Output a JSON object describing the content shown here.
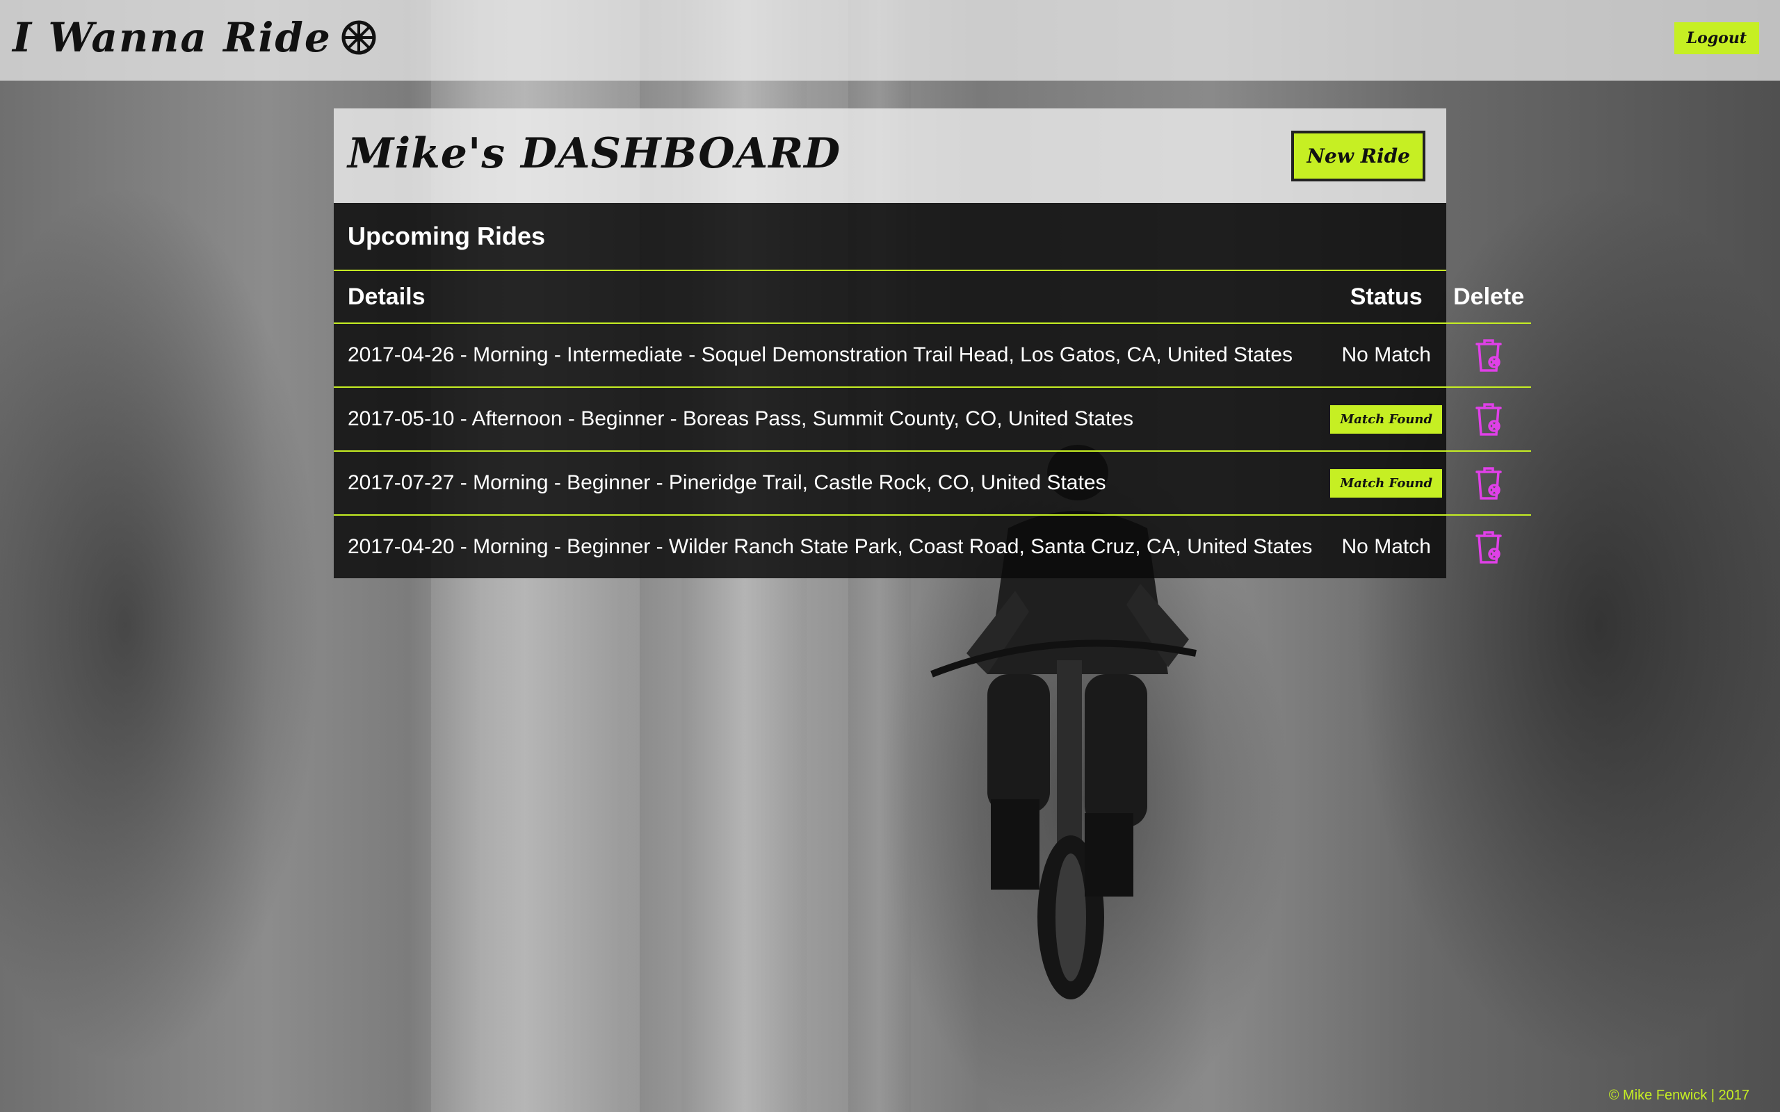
{
  "header": {
    "brand": "I Wanna Ride",
    "brand_icon": "gear-icon",
    "logout_label": "Logout"
  },
  "dashboard": {
    "title": "Mike's DASHBOARD",
    "new_ride_label": "New Ride"
  },
  "rides": {
    "title": "Upcoming Rides",
    "columns": {
      "details": "Details",
      "status": "Status",
      "delete": "Delete"
    },
    "rows": [
      {
        "details": "2017-04-26 - Morning - Intermediate - Soquel Demonstration Trail Head, Los Gatos, CA, United States",
        "status": "No Match"
      },
      {
        "details": "2017-05-10 - Afternoon - Beginner - Boreas Pass, Summit County, CO, United States",
        "status": "Match Found"
      },
      {
        "details": "2017-07-27 - Morning - Beginner - Pineridge Trail, Castle Rock, CO, United States",
        "status": "Match Found"
      },
      {
        "details": "2017-04-20 - Morning - Beginner - Wilder Ranch State Park, Coast Road, Santa Cruz, CA, United States",
        "status": "No Match"
      }
    ],
    "delete_icon": "trash-icon"
  },
  "footer": {
    "text": "© Mike Fenwick | 2017"
  },
  "colors": {
    "accent": "#c6ef23",
    "delete": "#e040e8",
    "panel_dark": "#0a0a0a"
  }
}
